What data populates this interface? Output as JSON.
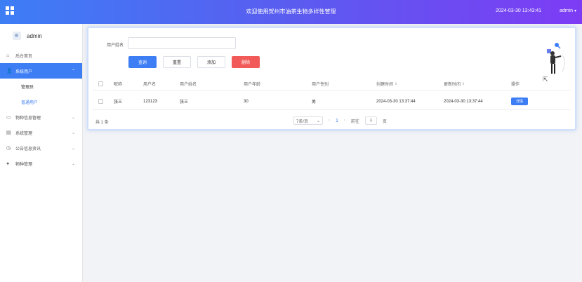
{
  "header": {
    "title": "欢迎使用贺州市油茶生物多样性管理",
    "datetime": "2024-03-30 13:43:41",
    "user": "admin"
  },
  "sidebar": {
    "profile_name": "admin",
    "items": [
      {
        "label": "后台首页",
        "icon": "home-icon"
      },
      {
        "label": "系统用户",
        "icon": "user-icon",
        "expanded": true,
        "children": [
          {
            "label": "管理员"
          },
          {
            "label": "普通用户"
          }
        ]
      },
      {
        "label": "物种信息管理",
        "icon": "document-icon"
      },
      {
        "label": "系统管理",
        "icon": "monitor-icon"
      },
      {
        "label": "公告信息资讯",
        "icon": "clock-icon"
      },
      {
        "label": "物种管理",
        "icon": "location-icon"
      }
    ]
  },
  "search": {
    "label": "用户姓名",
    "value": "",
    "placeholder": ""
  },
  "buttons": {
    "search": "查询",
    "reset": "重置",
    "add": "添加",
    "delete": "删除"
  },
  "table": {
    "columns": [
      "昵称",
      "用户名",
      "用户姓名",
      "用户年龄",
      "用户性别",
      "创建时间",
      "更新时间",
      "操作"
    ],
    "sort_icon": "⇕",
    "rows": [
      {
        "nickname": "张三",
        "username": "123123",
        "name": "张三",
        "age": "30",
        "gender": "男",
        "created": "2024-03-30 13:37:44",
        "updated": "2024-03-30 13:37:44",
        "action": "详情"
      }
    ]
  },
  "pagination": {
    "total": "共 1 条",
    "page_size": "7条/页",
    "current_page": "1",
    "goto_label": "前往",
    "goto_value": "1",
    "page_suffix": "页"
  },
  "colors": {
    "primary": "#3d7ef5",
    "danger": "#f25a5a",
    "header_gradient_end": "#7d3cf4"
  }
}
